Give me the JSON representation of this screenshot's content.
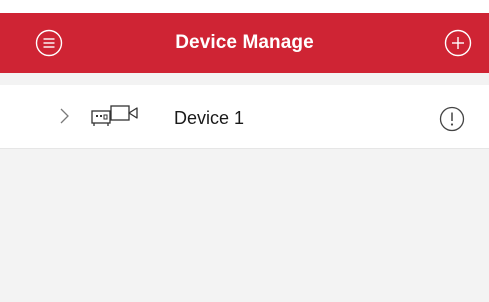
{
  "header": {
    "title": "Device Manage",
    "menu_icon": "menu-circle-icon",
    "add_icon": "add-circle-icon",
    "background_color": "#cf2434"
  },
  "devices": [
    {
      "name": "Device 1",
      "expand_icon": "chevron-right-icon",
      "type_icon": "dvr-device-icon",
      "status_icon": "exclamation-circle-icon"
    }
  ]
}
